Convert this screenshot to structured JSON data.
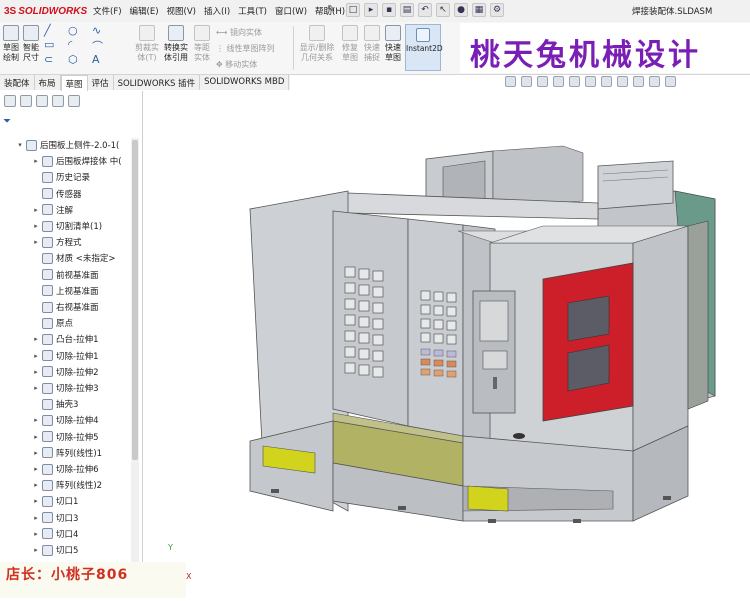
{
  "app": {
    "logo_prefix": "3S",
    "logo_name": "SOLIDWORKS",
    "filename": "焊接装配体.SLDASM"
  },
  "menu": [
    "文件(F)",
    "编辑(E)",
    "视图(V)",
    "插入(I)",
    "工具(T)",
    "窗口(W)",
    "帮助(H)"
  ],
  "ribbon": {
    "sketch_label": "草图\n绘制",
    "smartdim_label": "智能\n尺寸",
    "trim_label": "剪裁实\n体(T)",
    "convert_label": "转换实\n体引用",
    "offset_label": "等距\n实体",
    "mirror_label": "镜向实体",
    "linear_pattern_label": "线性草图阵列",
    "move_label": "移动实体",
    "show_relations_label": "显示/删除\n几何关系",
    "repair_label": "修复\n草图",
    "quick_snap_label": "快速\n捕捉",
    "rapid_sketch_label": "快速\n草图",
    "instant2d_label": "Instant2D"
  },
  "banner": "桃天兔机械设计",
  "tabs": [
    "装配体",
    "布局",
    "草图",
    "评估",
    "SOLIDWORKS 插件",
    "SOLIDWORKS MBD"
  ],
  "active_tab": "草图",
  "tree": [
    {
      "label": "后围板上侧件-2.0-1(",
      "expand": "▾",
      "indent": 20,
      "bold": false
    },
    {
      "label": "后围板焊接体 中(",
      "expand": "▸",
      "indent": 36
    },
    {
      "label": "历史记录",
      "expand": "",
      "indent": 36
    },
    {
      "label": "传感器",
      "expand": "",
      "indent": 36
    },
    {
      "label": "注解",
      "expand": "▸",
      "indent": 36
    },
    {
      "label": "切割清单(1)",
      "expand": "▸",
      "indent": 36
    },
    {
      "label": "方程式",
      "expand": "▸",
      "indent": 36
    },
    {
      "label": "材质 <未指定>",
      "expand": "",
      "indent": 36
    },
    {
      "label": "前视基准面",
      "expand": "",
      "indent": 36
    },
    {
      "label": "上视基准面",
      "expand": "",
      "indent": 36
    },
    {
      "label": "右视基准面",
      "expand": "",
      "indent": 36
    },
    {
      "label": "原点",
      "expand": "",
      "indent": 36
    },
    {
      "label": "凸台-拉伸1",
      "expand": "▸",
      "indent": 36
    },
    {
      "label": "切除-拉伸1",
      "expand": "▸",
      "indent": 36
    },
    {
      "label": "切除-拉伸2",
      "expand": "▸",
      "indent": 36
    },
    {
      "label": "切除-拉伸3",
      "expand": "▸",
      "indent": 36
    },
    {
      "label": "抽壳3",
      "expand": "",
      "indent": 36
    },
    {
      "label": "切除-拉伸4",
      "expand": "▸",
      "indent": 36
    },
    {
      "label": "切除-拉伸5",
      "expand": "▸",
      "indent": 36
    },
    {
      "label": "阵列(线性)1",
      "expand": "▸",
      "indent": 36
    },
    {
      "label": "切除-拉伸6",
      "expand": "▸",
      "indent": 36
    },
    {
      "label": "阵列(线性)2",
      "expand": "▸",
      "indent": 36
    },
    {
      "label": "切口1",
      "expand": "▸",
      "indent": 36
    },
    {
      "label": "切口3",
      "expand": "▸",
      "indent": 36
    },
    {
      "label": "切口4",
      "expand": "▸",
      "indent": 36
    },
    {
      "label": "切口5",
      "expand": "▸",
      "indent": 36
    }
  ],
  "footer": "店长：小桃子806",
  "axes": {
    "y": "Y",
    "x": "X"
  },
  "colors": {
    "brand": "#d0101a",
    "banner": "#7a1fb5",
    "accent_red": "#cc1f2a",
    "panel_olive": "#b2b265"
  }
}
